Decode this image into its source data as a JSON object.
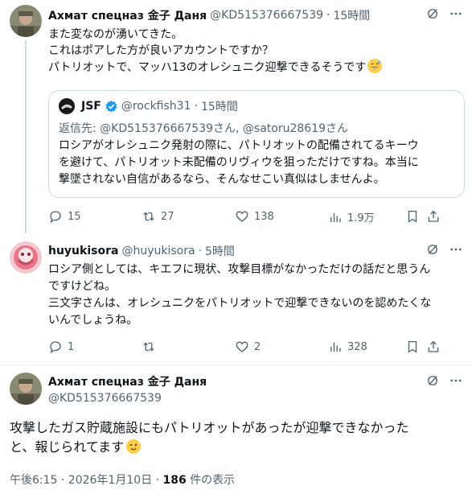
{
  "tweet1": {
    "author_name": "Ахмат спецназ 金子 Даня",
    "handle": "@KD515376667539",
    "time": "15時間",
    "lines": [
      "また変なのが湧いてきた。",
      "これはポアした方が良いアカウントですか？",
      "パトリオットで、マッハ13のオレシュニク迎撃できるそうです"
    ],
    "emoji": "grinning-face-with-sweat",
    "quote": {
      "author_name": "JSF",
      "handle": "@rockfish31",
      "time": "15時間",
      "reply_to": "返信先: @KD515376667539さん, @satoru28619さん",
      "lines": [
        "ロシアがオレシュニク発射の際に、パトリオットの配備されてるキーウ",
        "を避けて、パトリオット未配備のリヴィウを狙っただけですね。本当に",
        "撃墜されない自信があるなら、そんなせこい真似はしませんよ。"
      ]
    },
    "stats": {
      "replies": "15",
      "reposts": "27",
      "likes": "138",
      "views": "1.9万"
    }
  },
  "tweet2": {
    "author_name": "huyukisora",
    "handle": "@huyukisora",
    "time": "5時間",
    "lines": [
      "ロシア側としては、キエフに現状、攻撃目標がなかっただけの話だと思うん",
      "ですけどね。",
      "三文字さんは、オレシュニクをパトリオットで迎撃できないのを認めたくな",
      "いんでしょうね。"
    ],
    "stats": {
      "replies": "1",
      "reposts": "",
      "likes": "2",
      "views": "328"
    }
  },
  "tweet3": {
    "author_name": "Ахмат спецназ 金子 Даня",
    "handle": "@KD515376667539",
    "lines": [
      "攻撃したガス貯蔵施設にもパトリオットがあったが迎撃できなかった",
      "と、報じられてます"
    ],
    "emoji": "winking-face",
    "timestamp": "午後6:15 · 2026年1月10日 · ",
    "view_count": "186",
    "view_label": " 件の表示"
  },
  "colors": {
    "text": "#0f1419",
    "muted": "#536471",
    "line": "#cfd9de",
    "accent": "#1d9bf0"
  }
}
